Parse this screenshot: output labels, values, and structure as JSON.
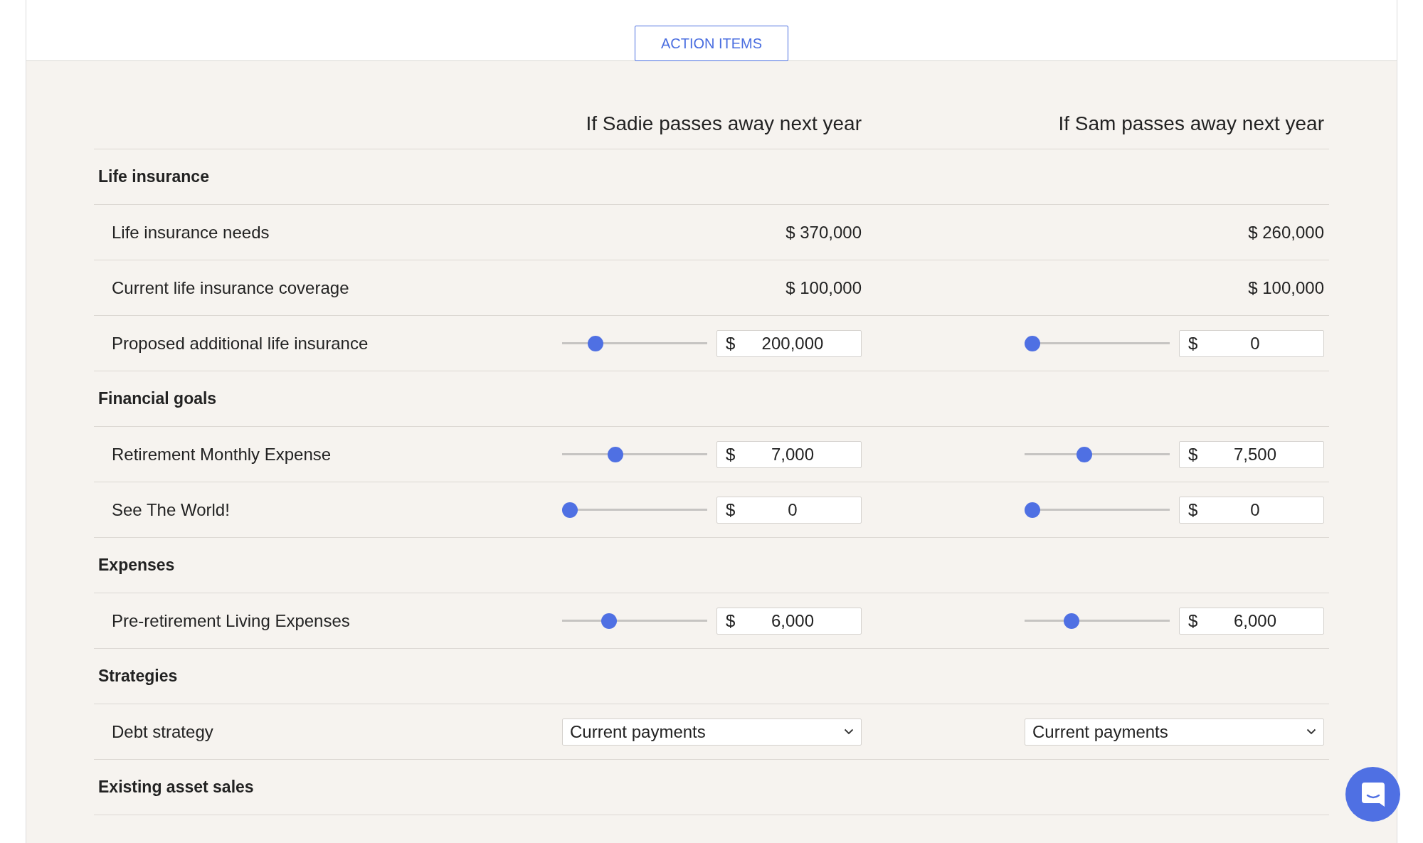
{
  "action_button": "ACTION ITEMS",
  "columns": [
    "If Sadie passes away next year",
    "If Sam passes away next year"
  ],
  "sections": [
    {
      "title": "Life insurance",
      "rows": [
        {
          "label": "Life insurance needs",
          "kind": "value",
          "cells": [
            {
              "value": "$ 370,000"
            },
            {
              "value": "$ 260,000"
            }
          ]
        },
        {
          "label": "Current life insurance coverage",
          "kind": "value",
          "cells": [
            {
              "value": "$ 100,000"
            },
            {
              "value": "$ 100,000"
            }
          ]
        },
        {
          "label": "Proposed additional life insurance",
          "kind": "slider",
          "cells": [
            {
              "level": 0.2,
              "currency": "$",
              "value": "200,000"
            },
            {
              "level": 0,
              "currency": "$",
              "value": "0"
            }
          ]
        }
      ]
    },
    {
      "title": "Financial goals",
      "rows": [
        {
          "label": "Retirement Monthly Expense",
          "kind": "slider",
          "cells": [
            {
              "level": 0.35,
              "currency": "$",
              "value": "7,000"
            },
            {
              "level": 0.4,
              "currency": "$",
              "value": "7,500"
            }
          ]
        },
        {
          "label": "See The World!",
          "kind": "slider",
          "cells": [
            {
              "level": 0,
              "currency": "$",
              "value": "0"
            },
            {
              "level": 0,
              "currency": "$",
              "value": "0"
            }
          ]
        }
      ]
    },
    {
      "title": "Expenses",
      "rows": [
        {
          "label": "Pre-retirement Living Expenses",
          "kind": "slider",
          "cells": [
            {
              "level": 0.3,
              "currency": "$",
              "value": "6,000"
            },
            {
              "level": 0.3,
              "currency": "$",
              "value": "6,000"
            }
          ]
        }
      ]
    },
    {
      "title": "Strategies",
      "rows": [
        {
          "label": "Debt strategy",
          "kind": "select",
          "cells": [
            {
              "value": "Current payments"
            },
            {
              "value": "Current payments"
            }
          ]
        }
      ]
    },
    {
      "title": "Existing asset sales"
    }
  ]
}
